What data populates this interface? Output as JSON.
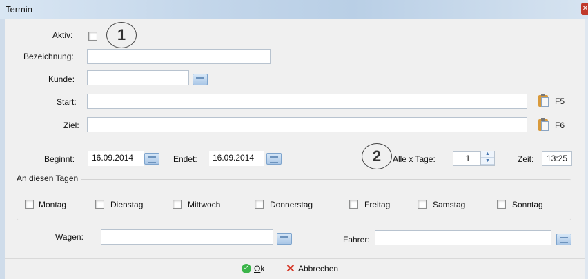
{
  "window": {
    "title": "Termin",
    "close_glyph": "✕"
  },
  "form": {
    "aktiv_label": "Aktiv:",
    "bezeichnung_label": "Bezeichnung:",
    "bezeichnung_value": "",
    "kunde_label": "Kunde:",
    "kunde_value": "",
    "start_label": "Start:",
    "start_value": "",
    "start_shortcut": "F5",
    "ziel_label": "Ziel:",
    "ziel_value": "",
    "ziel_shortcut": "F6",
    "beginnt_label": "Beginnt:",
    "beginnt_value": "16.09.2014",
    "endet_label": "Endet:",
    "endet_value": "16.09.2014",
    "alle_x_tage_label": "Alle x Tage:",
    "alle_x_tage_value": "1",
    "zeit_label": "Zeit:",
    "zeit_value": "13:25"
  },
  "annotations": {
    "marker_1": "1",
    "marker_2": "2"
  },
  "days": {
    "legend": "An diesen Tagen",
    "items": [
      "Montag",
      "Dienstag",
      "Mittwoch",
      "Donnerstag",
      "Freitag",
      "Samstag",
      "Sonntag"
    ]
  },
  "vehicle": {
    "wagen_label": "Wagen:",
    "wagen_value": "",
    "fahrer_label": "Fahrer:",
    "fahrer_value": ""
  },
  "buttons": {
    "ok_accel": "O",
    "ok_rest": "k",
    "cancel_label": "Abbrechen"
  },
  "icons": {
    "picker": "picker-icon",
    "clipboard": "clipboard-icon",
    "ok": "check-icon",
    "cancel": "x-icon"
  },
  "colors": {
    "titlebar": "#c3d6ea",
    "ok_green": "#3bb54a",
    "cancel_red": "#d63a2a",
    "clipboard": "#d99a3b"
  }
}
